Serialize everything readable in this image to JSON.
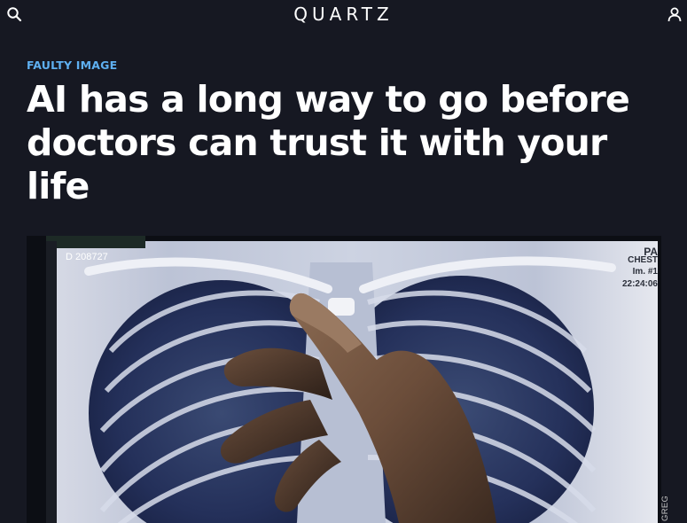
{
  "header": {
    "logo": "QUARTZ",
    "search_icon": "search-icon",
    "account_icon": "user-icon"
  },
  "article": {
    "kicker": "FAULTY IMAGE",
    "headline": "AI has a long way to go before doctors can trust it with your life",
    "image_overlay": {
      "id_text": "D 208727",
      "orientation_label": "PA",
      "region_label": "CHEST",
      "image_number": "Im. #1",
      "time": "22:24:06"
    },
    "photo_credit": "GREGOR"
  },
  "colors": {
    "background": "#161822",
    "kicker": "#5eaff0",
    "text": "#ffffff"
  }
}
